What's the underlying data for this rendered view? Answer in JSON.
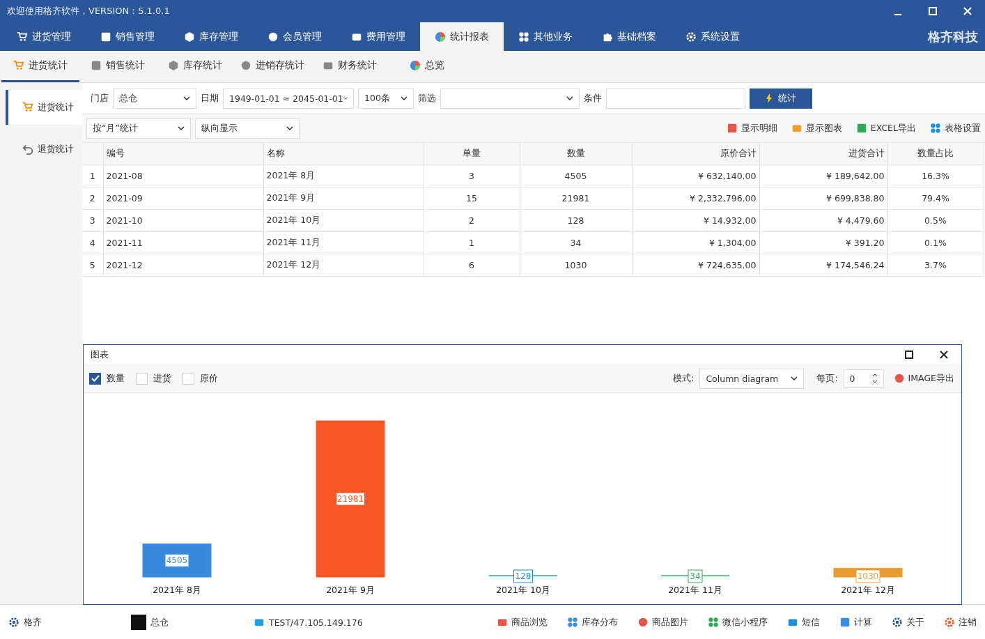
{
  "window": {
    "title": "欢迎使用格齐软件，VERSION：5.1.0.1",
    "brand": "格齐科技"
  },
  "menu_tabs": [
    {
      "label": "进货管理",
      "selected": false
    },
    {
      "label": "销售管理",
      "selected": false
    },
    {
      "label": "库存管理",
      "selected": false
    },
    {
      "label": "会员管理",
      "selected": false
    },
    {
      "label": "费用管理",
      "selected": false
    },
    {
      "label": "统计报表",
      "selected": true
    },
    {
      "label": "其他业务",
      "selected": false
    },
    {
      "label": "基础档案",
      "selected": false
    },
    {
      "label": "系统设置",
      "selected": false
    }
  ],
  "sub_tabs": [
    {
      "label": "进货统计",
      "selected": true
    },
    {
      "label": "销售统计",
      "selected": false
    },
    {
      "label": "库存统计",
      "selected": false
    },
    {
      "label": "进销存统计",
      "selected": false
    },
    {
      "label": "财务统计",
      "selected": false
    },
    {
      "label": "总览",
      "selected": false
    }
  ],
  "sidebar": {
    "items": [
      {
        "label": "进货统计",
        "selected": true
      },
      {
        "label": "退货统计",
        "selected": false
      }
    ]
  },
  "filters": {
    "store_label": "门店",
    "store": "总仓",
    "date_label": "日期",
    "date": "1949-01-01 ≈ 2045-01-01",
    "limit": "100条",
    "filter_label": "筛选",
    "condition_label": "条件",
    "submit": "统计",
    "group_by": "按“月”统计",
    "display": "纵向显示"
  },
  "actions": [
    "显示明细",
    "显示图表",
    "EXCEL导出",
    "表格设置"
  ],
  "table": {
    "columns": [
      "",
      "编号",
      "名称",
      "单量",
      "数量",
      "原价合计",
      "进货合计",
      "数量占比"
    ],
    "rows": [
      [
        "1",
        "2021-08",
        "2021年 8月",
        "3",
        "4505",
        "¥ 632,140.00",
        "¥ 189,642.00",
        "16.3%"
      ],
      [
        "2",
        "2021-09",
        "2021年 9月",
        "15",
        "21981",
        "¥ 2,332,796.00",
        "¥ 699,838.80",
        "79.4%"
      ],
      [
        "3",
        "2021-10",
        "2021年 10月",
        "2",
        "128",
        "¥ 14,932.00",
        "¥ 4,479.60",
        "0.5%"
      ],
      [
        "4",
        "2021-11",
        "2021年 11月",
        "1",
        "34",
        "¥ 1,304.00",
        "¥ 391.20",
        "0.1%"
      ],
      [
        "5",
        "2021-12",
        "2021年 12月",
        "6",
        "1030",
        "¥ 724,635.00",
        "¥ 174,546.24",
        "3.7%"
      ]
    ]
  },
  "chart_panel": {
    "title": "图表",
    "series_toggles": [
      {
        "label": "数量",
        "checked": true
      },
      {
        "label": "进货",
        "checked": false
      },
      {
        "label": "原价",
        "checked": false
      }
    ],
    "mode_label": "模式:",
    "mode": "Column diagram",
    "per_page_label": "每页:",
    "per_page": "0",
    "export": "IMAGE导出",
    "chart_data": {
      "type": "bar",
      "categories": [
        "2021年 8月",
        "2021年 9月",
        "2021年 10月",
        "2021年 11月",
        "2021年 12月"
      ],
      "data_labels": true,
      "series": [
        {
          "colors": [
            "#3a8ee6",
            "#ff5a26",
            "#1e90d6",
            "#2eaa5a",
            "#f0a030"
          ],
          "values": [
            4505,
            21981,
            128,
            34,
            1030
          ]
        }
      ]
    }
  },
  "status_bar": {
    "company": "格齐",
    "store": "总仓",
    "server": "TEST/47.105.149.176",
    "links": [
      "商品浏览",
      "库存分布",
      "商品图片",
      "微信小程序",
      "短信",
      "计算",
      "关于",
      "注销"
    ]
  }
}
